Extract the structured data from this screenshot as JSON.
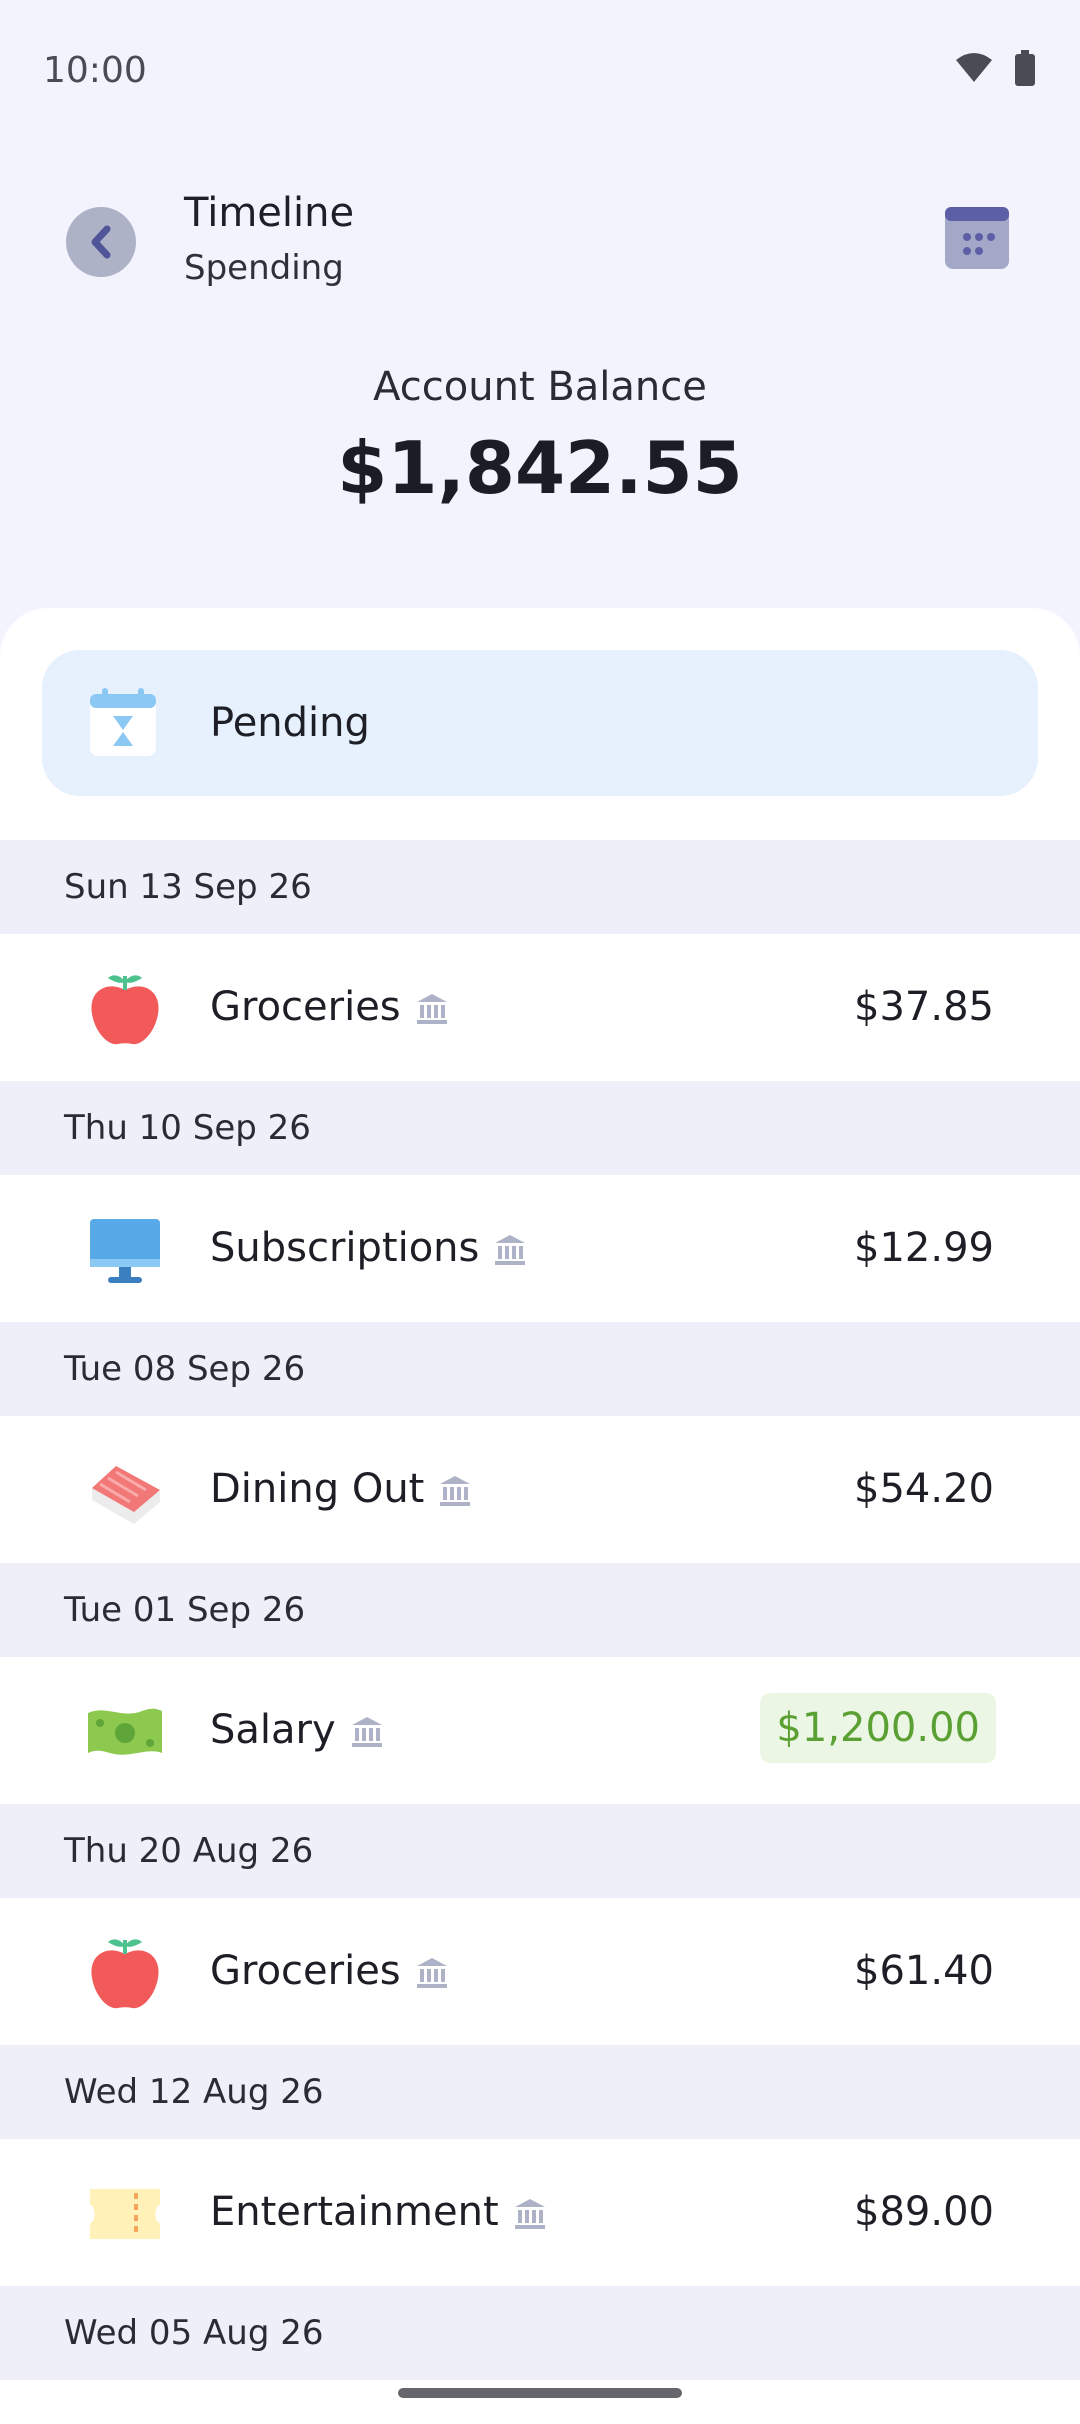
{
  "status": {
    "time": "10:00"
  },
  "header": {
    "title": "Timeline",
    "subtitle": "Spending"
  },
  "balance": {
    "label": "Account Balance",
    "value": "$1,842.55"
  },
  "pending": {
    "label": "Pending"
  },
  "groups": [
    {
      "date": "Sun 13 Sep 26",
      "tx": {
        "name": "Groceries",
        "amount": "$37.85",
        "icon": "apple-icon",
        "income": false
      }
    },
    {
      "date": "Thu 10 Sep 26",
      "tx": {
        "name": "Subscriptions",
        "amount": "$12.99",
        "icon": "monitor-icon",
        "income": false
      }
    },
    {
      "date": "Tue 08 Sep 26",
      "tx": {
        "name": "Dining Out",
        "amount": "$54.20",
        "icon": "sushi-icon",
        "income": false
      }
    },
    {
      "date": "Tue 01 Sep 26",
      "tx": {
        "name": "Salary",
        "amount": "$1,200.00",
        "icon": "cash-icon",
        "income": true
      }
    },
    {
      "date": "Thu 20 Aug 26",
      "tx": {
        "name": "Groceries",
        "amount": "$61.40",
        "icon": "apple-icon",
        "income": false
      }
    },
    {
      "date": "Wed 12 Aug 26",
      "tx": {
        "name": "Entertainment",
        "amount": "$89.00",
        "icon": "ticket-icon",
        "income": false
      }
    },
    {
      "date": "Wed 05 Aug 26"
    }
  ],
  "colors": {
    "income": "#5aa032",
    "income_bg": "#ecf6e4",
    "pending_bg": "#e6f1fd",
    "date_bg": "#eeeff9"
  }
}
